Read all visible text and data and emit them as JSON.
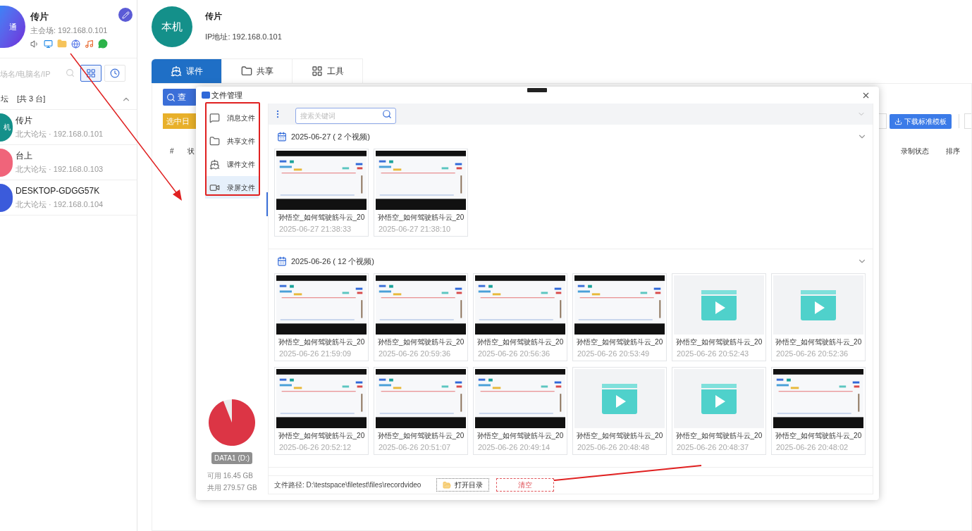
{
  "sidebar": {
    "header": {
      "avatar_text": "通",
      "name": "传片",
      "subtitle": "主会场: 192.168.0.101"
    },
    "search": {
      "placeholder": "场名/电脑名/IP"
    },
    "view_toggles": [
      {
        "kind": "grid",
        "selected": true
      },
      {
        "kind": "clock",
        "selected": false
      }
    ],
    "group": {
      "title": "坛",
      "count": "[共 3 台]",
      "expanded": true
    },
    "devices": [
      {
        "avatar_text": "机",
        "name": "传片",
        "detail": "北大论坛 · 192.168.0.101",
        "color": "#14908a"
      },
      {
        "name": "台上",
        "detail": "北大论坛 · 192.168.0.103",
        "color": "#f0647a"
      },
      {
        "name": "DESKTOP-GDGG57K",
        "detail": "北大论坛 · 192.168.0.104",
        "color": "#3b5bdb"
      }
    ]
  },
  "main": {
    "header": {
      "avatar_text": "本机",
      "name": "传片",
      "ip": "IP地址: 192.168.0.101"
    },
    "tabs": [
      {
        "label": "课件",
        "kind": "courseware",
        "selected": true
      },
      {
        "label": "共享",
        "kind": "share",
        "selected": false
      },
      {
        "label": "工具",
        "kind": "tools",
        "selected": false
      }
    ],
    "query_button": "查",
    "date_button": "选中日",
    "table_headers_left": [
      "#",
      "状"
    ],
    "download_button": "下载标准模板",
    "table_headers_right": [
      "录制状态",
      "排序"
    ]
  },
  "dialog": {
    "title": "文件管理",
    "nav": [
      {
        "label": "消息文件",
        "kind": "message",
        "selected": false
      },
      {
        "label": "共享文件",
        "kind": "share",
        "selected": false
      },
      {
        "label": "课件文件",
        "kind": "courseware",
        "selected": false
      },
      {
        "label": "录屏文件",
        "kind": "record",
        "selected": true
      }
    ],
    "disk": {
      "label": "DATA1 (D:)",
      "free": "可用 16.45 GB",
      "total": "共用 279.57 GB"
    },
    "search": {
      "placeholder": "搜索关键词"
    },
    "groups": [
      {
        "date_label": "2025-06-27 ( 2 个视频)",
        "expanded": true,
        "videos": [
          {
            "title": "孙悟空_如何驾驶筋斗云_20",
            "time": "2025-06-27 21:38:33",
            "kind": "thumbnail"
          },
          {
            "title": "孙悟空_如何驾驶筋斗云_20",
            "time": "2025-06-27 21:38:10",
            "kind": "thumbnail"
          }
        ]
      },
      {
        "date_label": "2025-06-26 ( 12 个视频)",
        "expanded": true,
        "videos": [
          {
            "title": "孙悟空_如何驾驶筋斗云_20",
            "time": "2025-06-26 21:59:09",
            "kind": "thumbnail"
          },
          {
            "title": "孙悟空_如何驾驶筋斗云_20",
            "time": "2025-06-26 20:59:36",
            "kind": "thumbnail"
          },
          {
            "title": "孙悟空_如何驾驶筋斗云_20",
            "time": "2025-06-26 20:56:36",
            "kind": "thumbnail"
          },
          {
            "title": "孙悟空_如何驾驶筋斗云_20",
            "time": "2025-06-26 20:53:49",
            "kind": "thumbnail"
          },
          {
            "title": "孙悟空_如何驾驶筋斗云_20",
            "time": "2025-06-26 20:52:43",
            "kind": "placeholder"
          },
          {
            "title": "孙悟空_如何驾驶筋斗云_20",
            "time": "2025-06-26 20:52:36",
            "kind": "placeholder"
          },
          {
            "title": "孙悟空_如何驾驶筋斗云_20",
            "time": "2025-06-26 20:52:12",
            "kind": "thumbnail"
          },
          {
            "title": "孙悟空_如何驾驶筋斗云_20",
            "time": "2025-06-26 20:51:07",
            "kind": "thumbnail"
          },
          {
            "title": "孙悟空_如何驾驶筋斗云_20",
            "time": "2025-06-26 20:49:14",
            "kind": "thumbnail"
          },
          {
            "title": "孙悟空_如何驾驶筋斗云_20",
            "time": "2025-06-26 20:48:48",
            "kind": "placeholder"
          },
          {
            "title": "孙悟空_如何驾驶筋斗云_20",
            "time": "2025-06-26 20:48:37",
            "kind": "placeholder"
          },
          {
            "title": "孙悟空_如何驾驶筋斗云_20",
            "time": "2025-06-26 20:48:02",
            "kind": "thumbnail"
          }
        ]
      }
    ],
    "footer": {
      "path": "文件路径: D:\\testspace\\filetest\\files\\recordvideo",
      "open_button": "打开目录",
      "clear_button": "清空"
    }
  }
}
